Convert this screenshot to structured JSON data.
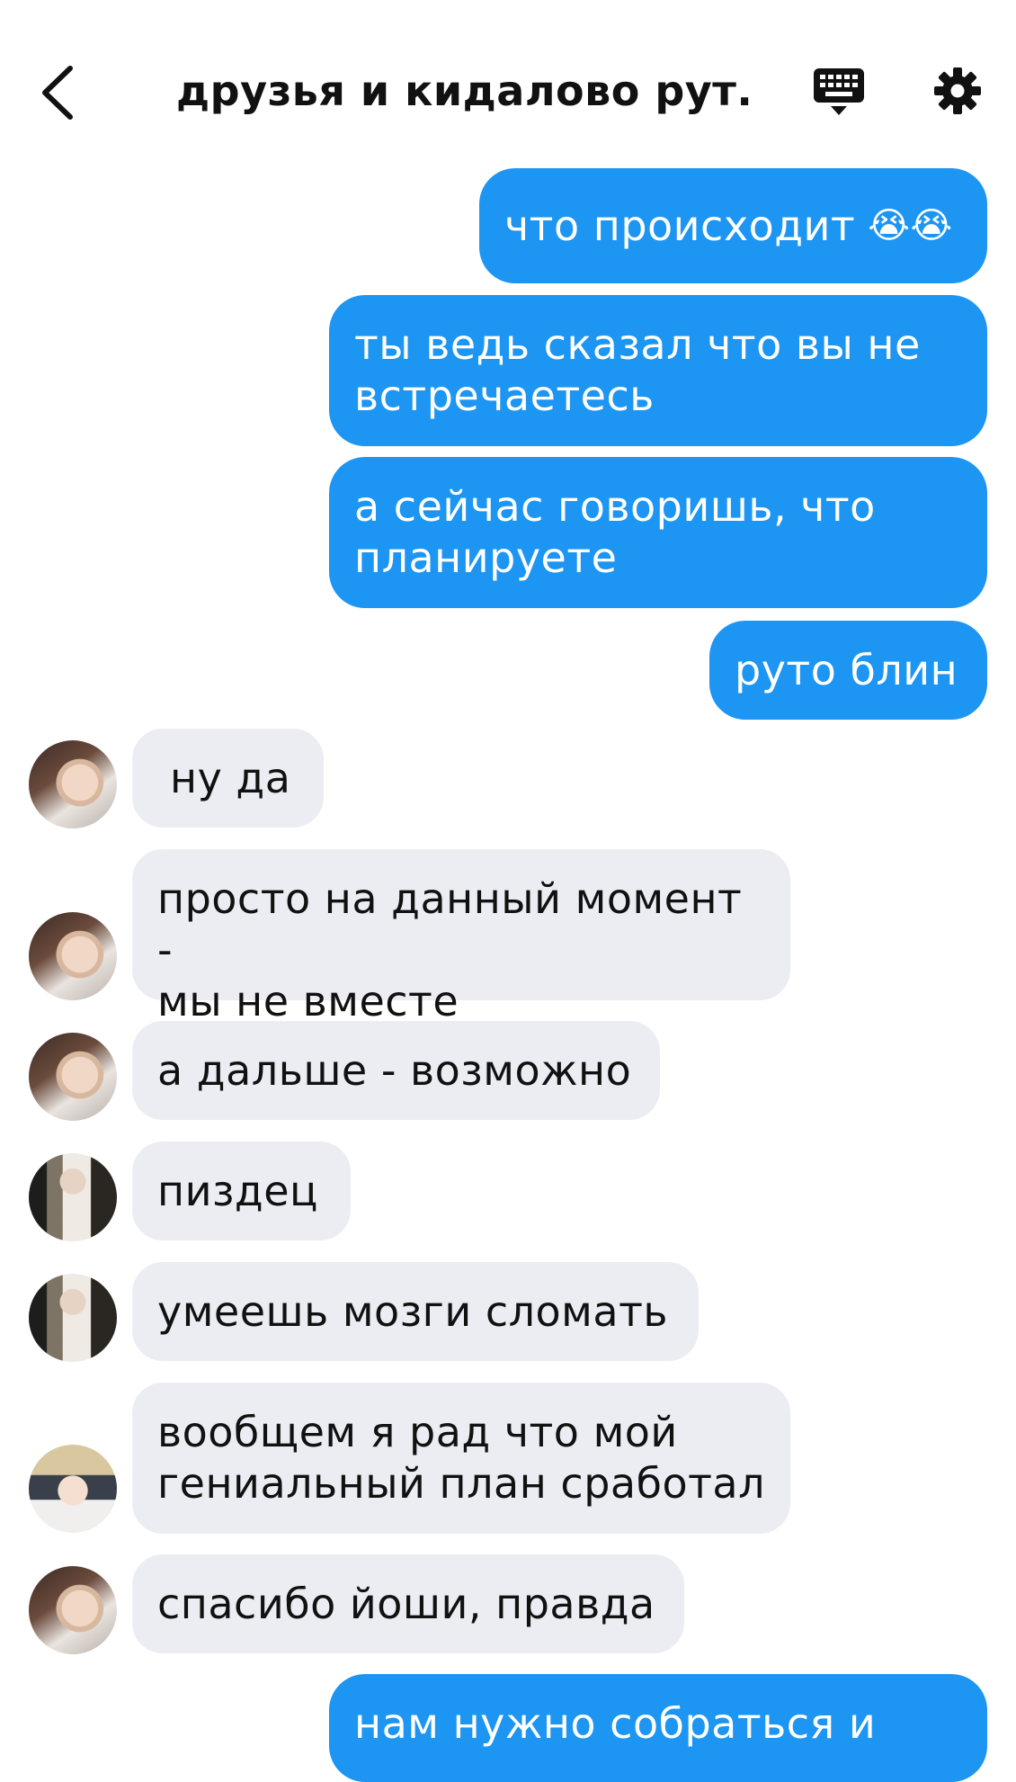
{
  "header": {
    "title": "друзья и кидалово рут...",
    "back_icon": "chevron-left-icon",
    "keyboard_icon": "keyboard-icon",
    "settings_icon": "gear-icon"
  },
  "colors": {
    "outgoing_bubble": "#1c95f3",
    "incoming_bubble": "#ecedf3",
    "text_dark": "#111111"
  },
  "messages": [
    {
      "text": "что происходит",
      "emoji": "😭😭"
    },
    {
      "line1": "ты ведь сказал что вы не",
      "line2": "встречаетесь"
    },
    {
      "line1": "а сейчас говоришь, что",
      "line2": "планируете"
    },
    {
      "text": "руто блин"
    },
    {
      "text": "ну да"
    },
    {
      "line1": "просто на данный момент -",
      "line2": "мы не вместе"
    },
    {
      "text": "а дальше - возможно"
    },
    {
      "text": "пиздец"
    },
    {
      "text": "умеешь мозги сломать"
    },
    {
      "line1": "вообщем я рад что мой",
      "line2": "гениальный план сработал"
    },
    {
      "text": "спасибо йоши, правда"
    },
    {
      "line1": "нам нужно собраться и"
    }
  ]
}
